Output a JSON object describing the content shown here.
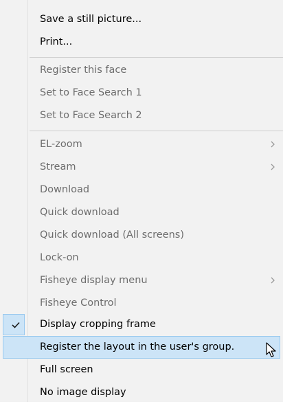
{
  "menu": {
    "items": [
      {
        "label": "Save a still picture...",
        "enabled": true
      },
      {
        "label": "Print...",
        "enabled": true
      },
      {
        "label": "Register this face",
        "enabled": false
      },
      {
        "label": "Set to Face Search 1",
        "enabled": false
      },
      {
        "label": "Set to Face Search 2",
        "enabled": false
      },
      {
        "label": "EL-zoom",
        "enabled": false,
        "submenu": true
      },
      {
        "label": "Stream",
        "enabled": false,
        "submenu": true
      },
      {
        "label": "Download",
        "enabled": false
      },
      {
        "label": "Quick download",
        "enabled": false
      },
      {
        "label": "Quick download (All screens)",
        "enabled": false
      },
      {
        "label": "Lock-on",
        "enabled": false
      },
      {
        "label": "Fisheye display menu",
        "enabled": false,
        "submenu": true
      },
      {
        "label": "Fisheye Control",
        "enabled": false
      },
      {
        "label": "Display cropping frame",
        "enabled": true,
        "checked": true
      },
      {
        "label": "Register the layout in the user's group.",
        "enabled": true,
        "highlighted": true
      },
      {
        "label": "Full screen",
        "enabled": true
      },
      {
        "label": "No image display",
        "enabled": true
      }
    ]
  },
  "colors": {
    "menu_background": "#f2f2f2",
    "highlight_fill": "#cce4f7",
    "highlight_border": "#99c9ef",
    "disabled_text": "#6d6d6d",
    "enabled_text": "#000000"
  },
  "icons": {
    "check": "check-icon",
    "submenu": "chevron-right-icon",
    "cursor": "mouse-pointer-icon"
  }
}
